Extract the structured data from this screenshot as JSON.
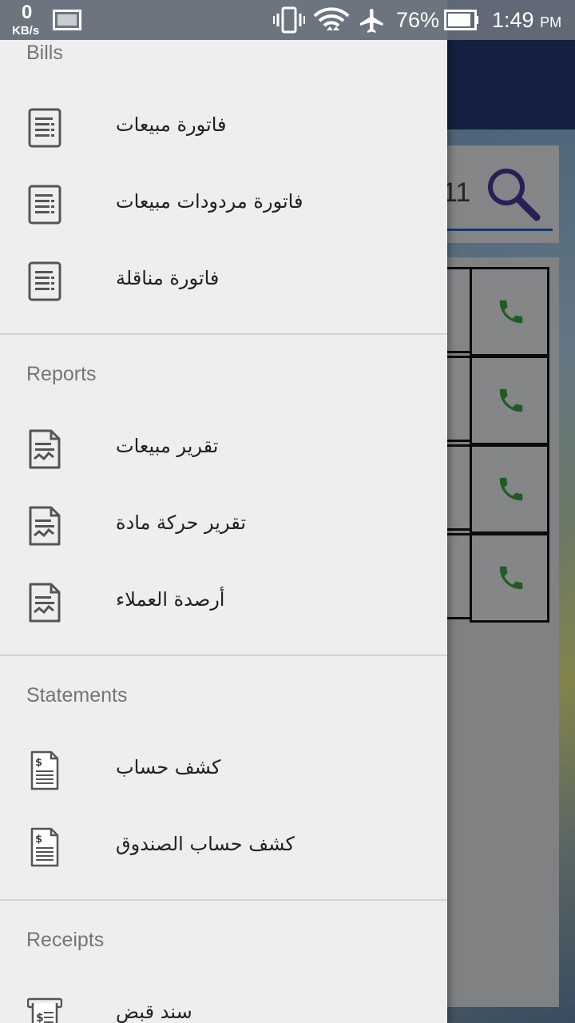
{
  "status_bar": {
    "speed": "0",
    "speed_unit": "KB/s",
    "battery": "76%",
    "time": "1:49",
    "ampm": "PM"
  },
  "background": {
    "search_value": "11"
  },
  "drawer": {
    "bills": {
      "header": "Bills",
      "items": [
        {
          "label": "فاتورة مبيعات",
          "icon": "invoice-icon"
        },
        {
          "label": "فاتورة مردودات مبيعات",
          "icon": "invoice-icon"
        },
        {
          "label": "فاتورة مناقلة",
          "icon": "invoice-icon"
        }
      ]
    },
    "reports": {
      "header": "Reports",
      "items": [
        {
          "label": "تقرير مبيعات",
          "icon": "report-icon"
        },
        {
          "label": "تقرير حركة مادة",
          "icon": "report-icon"
        },
        {
          "label": "أرصدة العملاء",
          "icon": "report-icon"
        }
      ]
    },
    "statements": {
      "header": "Statements",
      "items": [
        {
          "label": "كشف حساب",
          "icon": "dollar-document-icon"
        },
        {
          "label": "كشف حساب الصندوق",
          "icon": "dollar-document-icon"
        }
      ]
    },
    "receipts": {
      "header": "Receipts",
      "items": [
        {
          "label": "سند قبض",
          "icon": "receipt-icon"
        }
      ]
    }
  },
  "colors": {
    "drawer_bg": "#eeeeee",
    "header_text": "#757575",
    "phone_green": "#2e7d32",
    "app_bar": "#1b2d5a"
  }
}
